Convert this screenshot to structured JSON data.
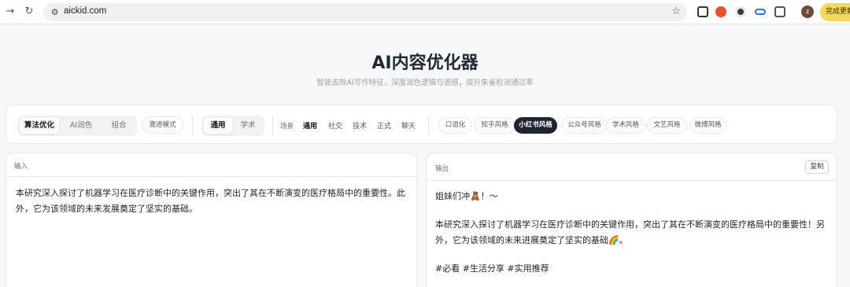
{
  "browser": {
    "url": "aickid.com",
    "update_label": "完成更新",
    "profile_initial": "z"
  },
  "header": {
    "title": "AI内容优化器",
    "subtitle": "智能去除AI写作特征，深度润色逻辑与语感，提升朱雀检测通过率"
  },
  "toolbar": {
    "modes": [
      "算法优化",
      "AI润色",
      "组合"
    ],
    "aggressive_label": "激进模式",
    "domains": [
      "通用",
      "学术"
    ],
    "scene_label": "场景",
    "scenes": [
      "通用",
      "社交",
      "技术",
      "正式",
      "聊天"
    ],
    "styles": [
      "口语化",
      "知乎风格",
      "小红书风格",
      "公众号风格",
      "学术风格",
      "文艺风格",
      "微博风格"
    ]
  },
  "input_panel": {
    "label": "输入",
    "text": "本研究深入探讨了机器学习在医疗诊断中的关键作用，突出了其在不断演变的医疗格局中的重要性。此外，它为该领域的未来发展奠定了坚实的基础。"
  },
  "output_panel": {
    "label": "输出",
    "copy_label": "复制",
    "line1": "姐妹们冲🧸！～",
    "line2": "本研究深入探讨了机器学习在医疗诊断中的关键作用，突出了其在不断演变的医疗格局中的重要性！另外，它为该领域的未来进展奠定了坚实的基础🌈。",
    "line3": "#必看 #生活分享 #实用推荐"
  },
  "colors": {
    "accent_dark": "#1f2433",
    "update_button": "#f7d85e"
  }
}
